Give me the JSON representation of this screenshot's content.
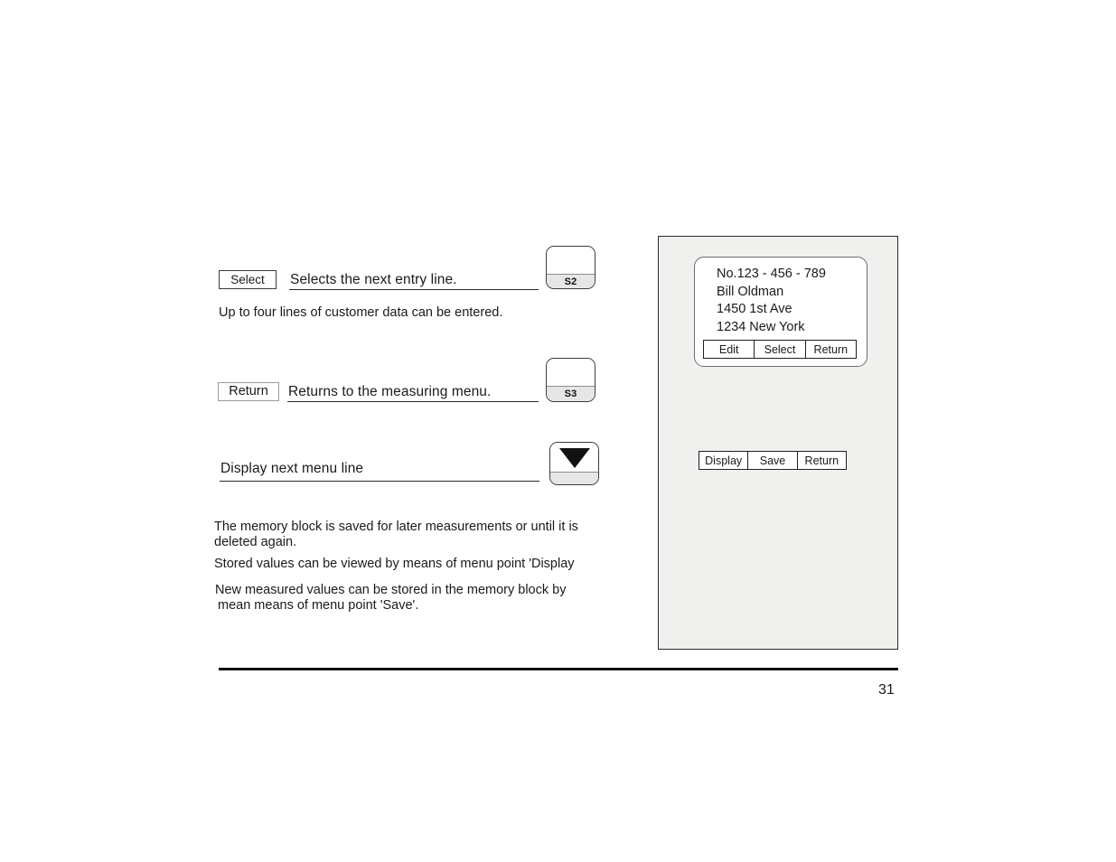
{
  "document": {
    "page_number": "31"
  },
  "key_rows": [
    {
      "softkey_label": "Select",
      "description": "Selects the next entry line.",
      "hardware_key": "S2"
    },
    {
      "softkey_label": "Return",
      "description": "Returns to the measuring menu.",
      "hardware_key": "S3"
    },
    {
      "softkey_label": "",
      "description": "Display next menu line",
      "hardware_key": "arrow-down-icon"
    }
  ],
  "notes": {
    "after_select": "Up to  four lines of customer data can be entered.",
    "paragraph_1_line_1": "The  memory  block  is  saved  for  later  measurements  or  until  it  is",
    "paragraph_1_line_2": "deleted again.",
    "paragraph_2": "Stored values can be viewed by means of menu point 'Display",
    "paragraph_3_line_1": "New measured values can be stored in the memory block by",
    "paragraph_3_line_2": "mean means  of menu point 'Save'."
  },
  "device": {
    "lcd": {
      "lines": [
        "No.123 - 456 - 789",
        "Bill Oldman",
        "1450 1st Ave",
        "1234 New York"
      ],
      "buttons": [
        "Edit",
        "Select",
        "Return"
      ]
    },
    "panel_buttons": [
      "Display",
      "Save",
      "Return"
    ]
  }
}
